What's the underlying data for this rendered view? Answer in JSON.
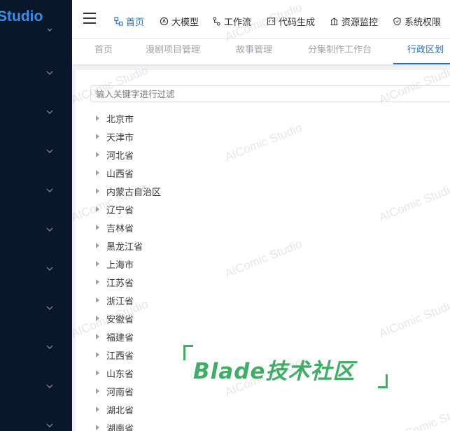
{
  "sidebar": {
    "logo_text": "Studio",
    "item_count": 10
  },
  "topbar": {
    "menu": [
      {
        "label": "首页",
        "icon": "home-icon",
        "active": true
      },
      {
        "label": "大模型",
        "icon": "model-icon",
        "active": false
      },
      {
        "label": "工作流",
        "icon": "workflow-icon",
        "active": false
      },
      {
        "label": "代码生成",
        "icon": "code-icon",
        "active": false
      },
      {
        "label": "资源监控",
        "icon": "monitor-icon",
        "active": false
      },
      {
        "label": "系统权限",
        "icon": "shield-icon",
        "active": false
      }
    ]
  },
  "tabs": [
    {
      "label": "首页",
      "active": false
    },
    {
      "label": "漫剧项目管理",
      "active": false
    },
    {
      "label": "故事管理",
      "active": false
    },
    {
      "label": "分集制作工作台",
      "active": false
    },
    {
      "label": "行政区划",
      "active": true
    }
  ],
  "filter": {
    "placeholder": "输入关键字进行过滤"
  },
  "tree": [
    "北京市",
    "天津市",
    "河北省",
    "山西省",
    "内蒙古自治区",
    "辽宁省",
    "吉林省",
    "黑龙江省",
    "上海市",
    "江苏省",
    "浙江省",
    "安徽省",
    "福建省",
    "江西省",
    "山东省",
    "河南省",
    "湖北省",
    "湖南省"
  ],
  "watermark": "AIComic Studio",
  "badge": {
    "text": "Blade技术社区",
    "color": "#3fae65"
  },
  "colors": {
    "accent": "#1e6fd9",
    "sidebar_bg": "#0a1629"
  }
}
